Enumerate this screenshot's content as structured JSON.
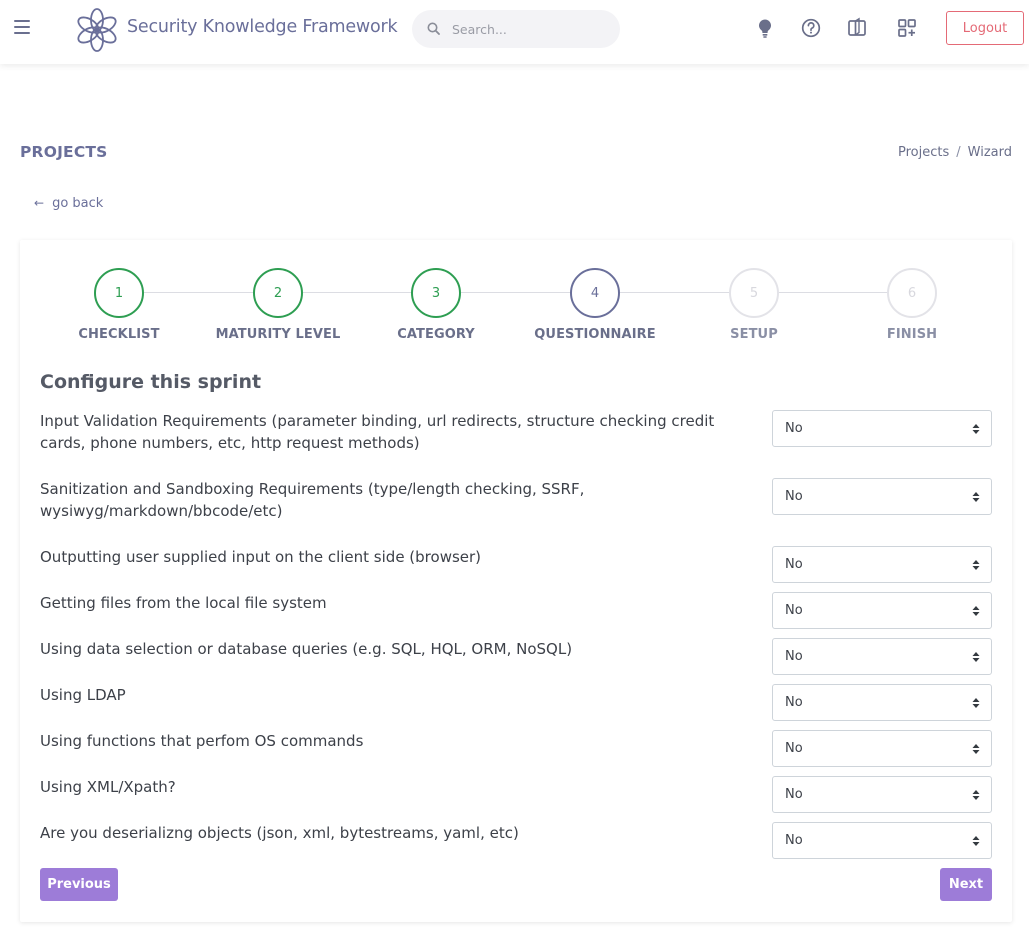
{
  "header": {
    "brand": "Security Knowledge Framework",
    "search_placeholder": "Search...",
    "logout_label": "Logout",
    "icons": [
      "menu-icon",
      "skf-logo",
      "search-icon",
      "lightbulb-icon",
      "help-icon",
      "layout-icon",
      "apps-add-icon"
    ]
  },
  "page": {
    "title": "PROJECTS",
    "breadcrumb": [
      "Projects",
      "Wizard"
    ],
    "breadcrumb_sep": "/",
    "go_back_label": "go back"
  },
  "wizard": {
    "steps": [
      {
        "number": "1",
        "label": "CHECKLIST",
        "state": "done"
      },
      {
        "number": "2",
        "label": "MATURITY LEVEL",
        "state": "done"
      },
      {
        "number": "3",
        "label": "CATEGORY",
        "state": "done"
      },
      {
        "number": "4",
        "label": "QUESTIONNAIRE",
        "state": "active"
      },
      {
        "number": "5",
        "label": "SETUP",
        "state": "todo"
      },
      {
        "number": "6",
        "label": "FINISH",
        "state": "todo"
      }
    ],
    "section_title": "Configure this sprint",
    "questions": [
      {
        "text": "Input Validation Requirements (parameter binding, url redirects, structure checking credit cards, phone numbers, etc, http request methods)",
        "answer": "No"
      },
      {
        "text": "Sanitization and Sandboxing Requirements (type/length checking, SSRF, wysiwyg/markdown/bbcode/etc)",
        "answer": "No"
      },
      {
        "text": "Outputting user supplied input on the client side (browser)",
        "answer": "No"
      },
      {
        "text": "Getting files from the local file system",
        "answer": "No"
      },
      {
        "text": "Using data selection or database queries (e.g. SQL, HQL, ORM, NoSQL)",
        "answer": "No"
      },
      {
        "text": "Using LDAP",
        "answer": "No"
      },
      {
        "text": "Using functions that perfom OS commands",
        "answer": "No"
      },
      {
        "text": "Using XML/Xpath?",
        "answer": "No"
      },
      {
        "text": "Are you deserializng objects (json, xml, bytestreams, yaml, etc)",
        "answer": "No"
      }
    ],
    "previous_label": "Previous",
    "next_label": "Next"
  },
  "colors": {
    "brand": "#6a6f9a",
    "done": "#2e9e52",
    "accent_button": "#9d7cd8",
    "logout": "#e46a76"
  }
}
